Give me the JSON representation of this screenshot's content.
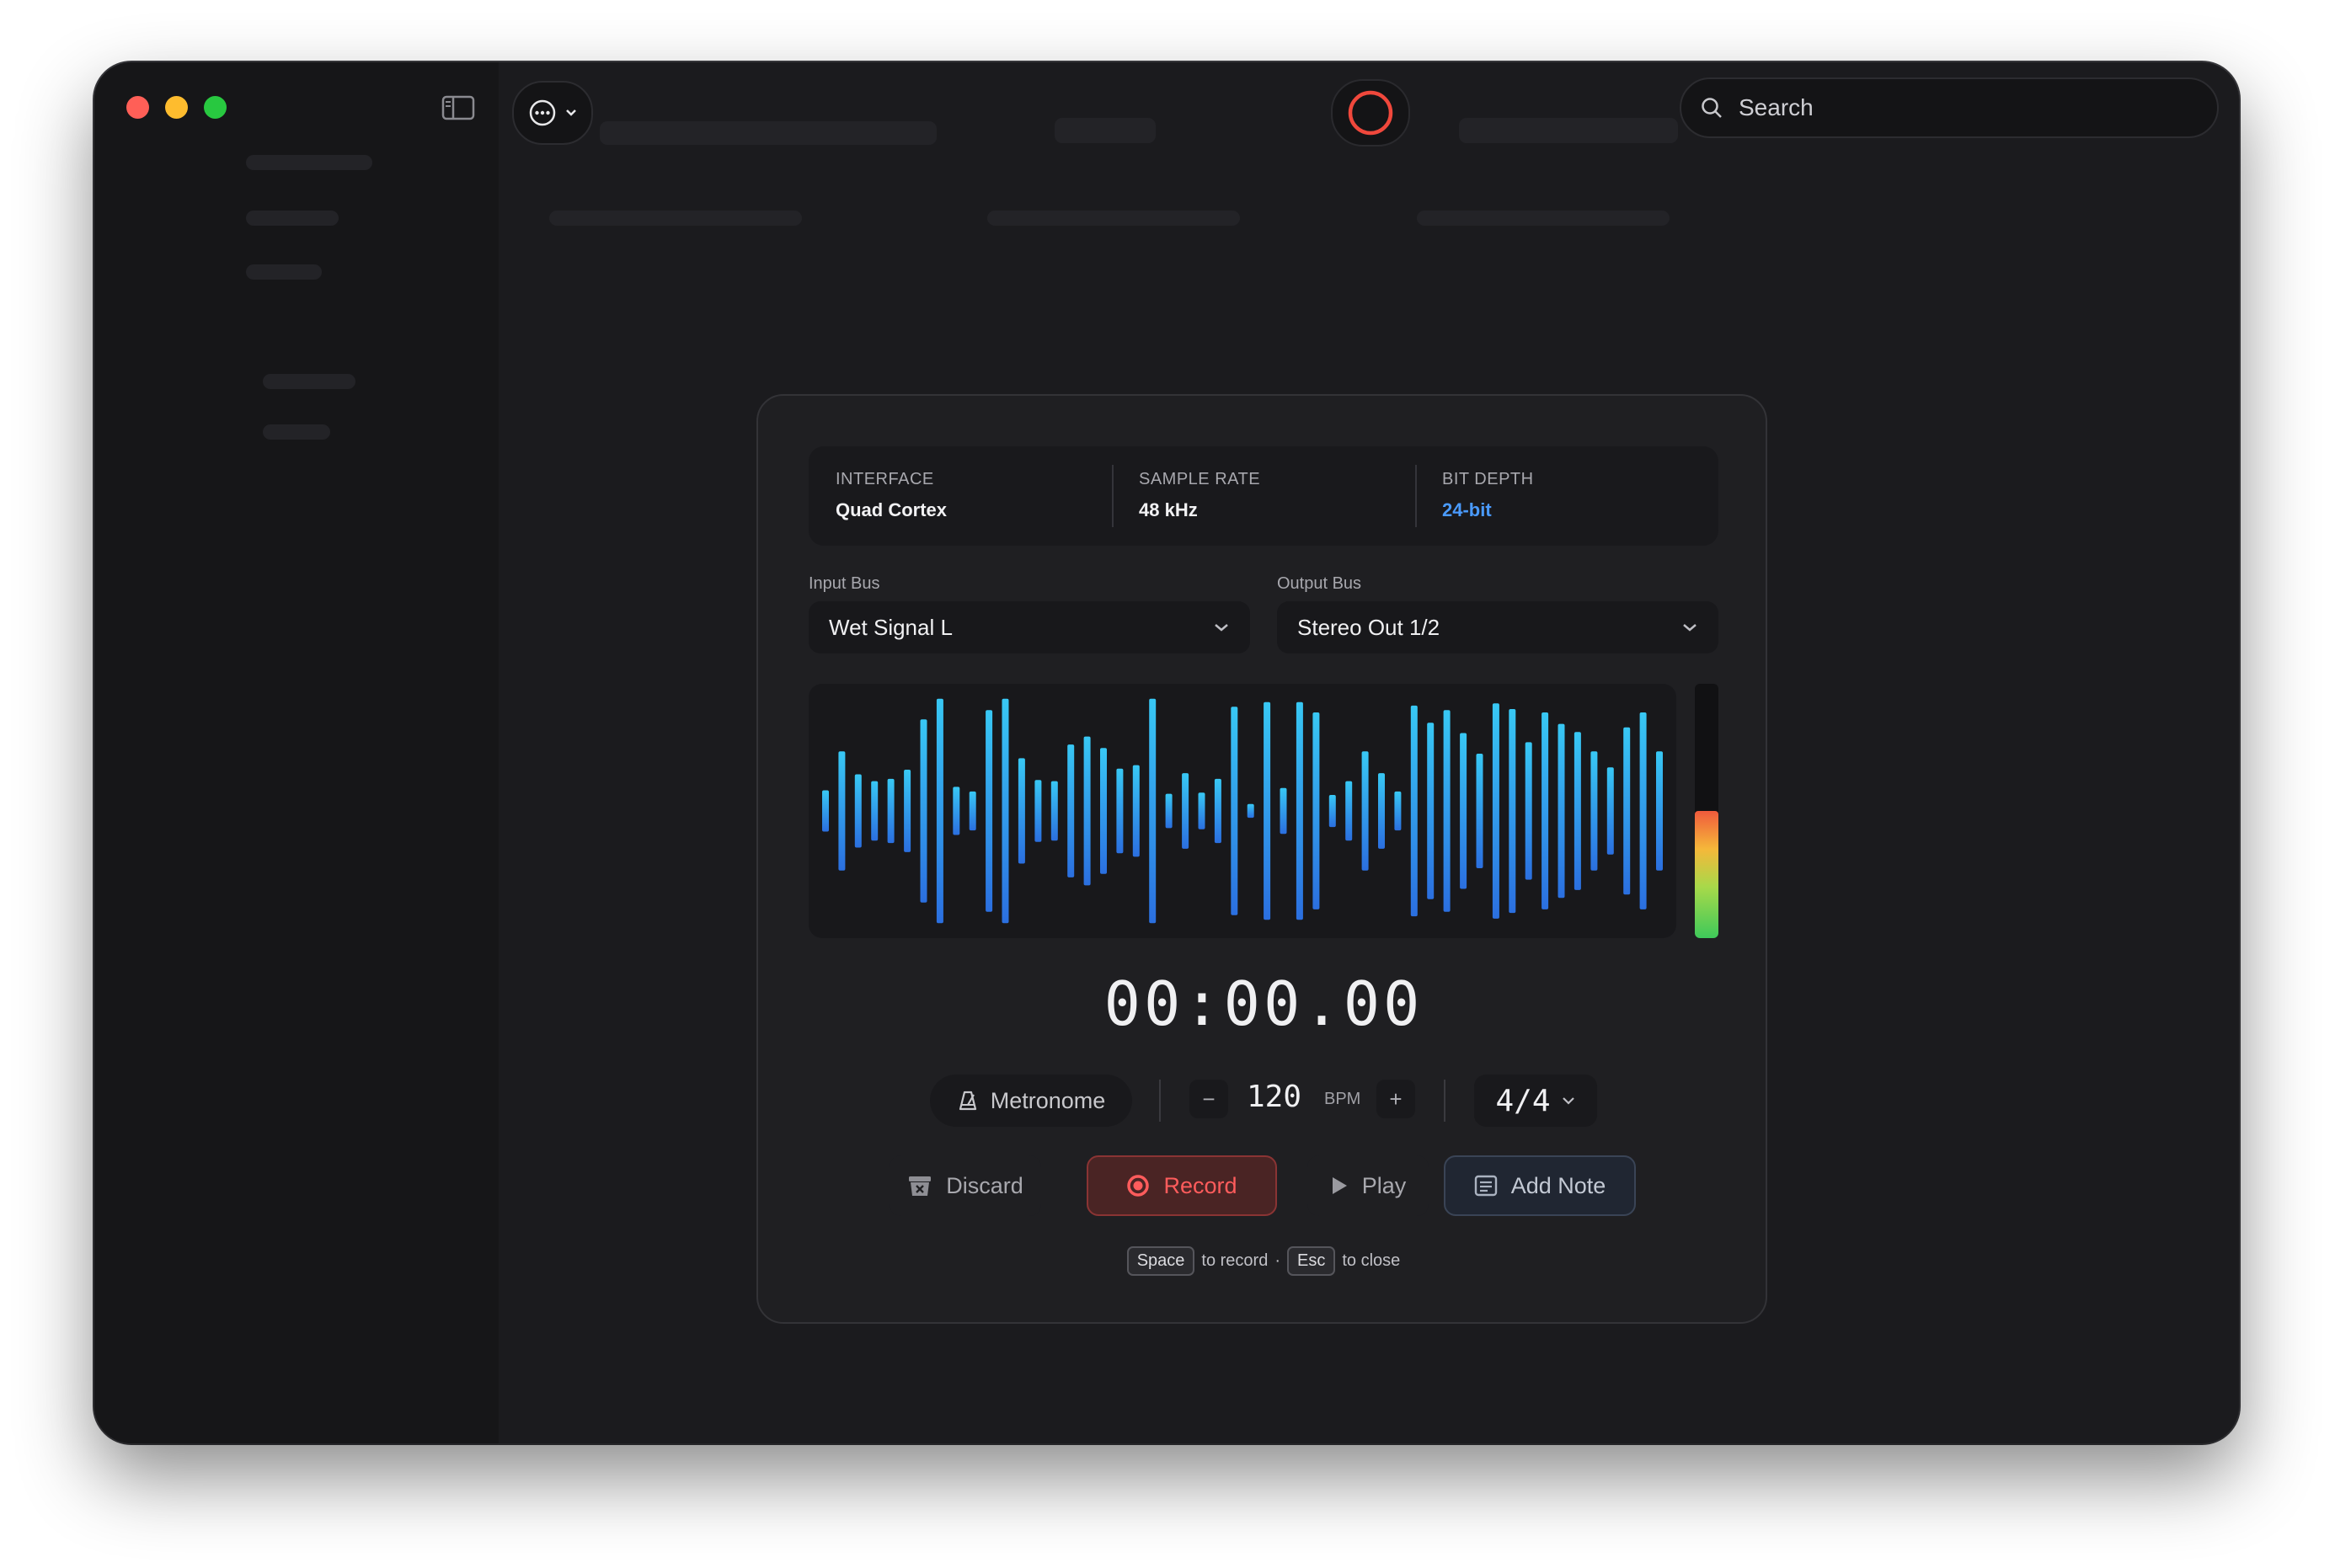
{
  "search": {
    "placeholder": "Search"
  },
  "colors": {
    "accent": "#4a9bff",
    "record": "#ff5c5c",
    "waveform_top": "#38c8f4",
    "waveform_bottom": "#2b6fe0",
    "traffic_close": "#ff5f57",
    "traffic_min": "#febc2e",
    "traffic_max": "#28c840"
  },
  "icons": {
    "sidebar_toggle": "sidebar-icon",
    "more": "ellipsis-circle-icon",
    "record_status": "record-ring-icon",
    "search": "magnifier-icon"
  },
  "dialog": {
    "info": [
      {
        "label": "INTERFACE",
        "value": "Quad Cortex"
      },
      {
        "label": "SAMPLE RATE",
        "value": "48 kHz"
      },
      {
        "label": "BIT DEPTH",
        "value": "24-bit"
      }
    ],
    "input_bus": {
      "label": "Input Bus",
      "value": "Wet Signal L"
    },
    "output_bus": {
      "label": "Output Bus",
      "value": "Stereo Out 1/2"
    },
    "waveform_amplitudes": [
      0.18,
      0.52,
      0.32,
      0.26,
      0.28,
      0.36,
      0.8,
      0.98,
      0.21,
      0.17,
      0.88,
      0.98,
      0.46,
      0.27,
      0.26,
      0.58,
      0.65,
      0.55,
      0.37,
      0.4,
      0.98,
      0.15,
      0.33,
      0.16,
      0.28,
      0.91,
      0.06,
      0.95,
      0.2,
      0.95,
      0.86,
      0.14,
      0.26,
      0.52,
      0.33,
      0.17,
      0.92,
      0.77,
      0.88,
      0.68,
      0.5,
      0.94,
      0.89,
      0.6,
      0.86,
      0.76,
      0.69,
      0.52,
      0.38,
      0.73,
      0.86,
      0.52
    ],
    "meter_level": 0.5,
    "timer": "00:00.00",
    "metronome_label": "Metronome",
    "bpm_minus": "−",
    "bpm_value": "120",
    "bpm_unit": "BPM",
    "bpm_plus": "+",
    "time_signature": "4/4",
    "buttons": {
      "discard": "Discard",
      "record": "Record",
      "play": "Play",
      "add_note": "Add Note"
    },
    "hint": {
      "key1": "Space",
      "text1": "to record",
      "dot": "·",
      "key2": "Esc",
      "text2": "to close"
    }
  }
}
